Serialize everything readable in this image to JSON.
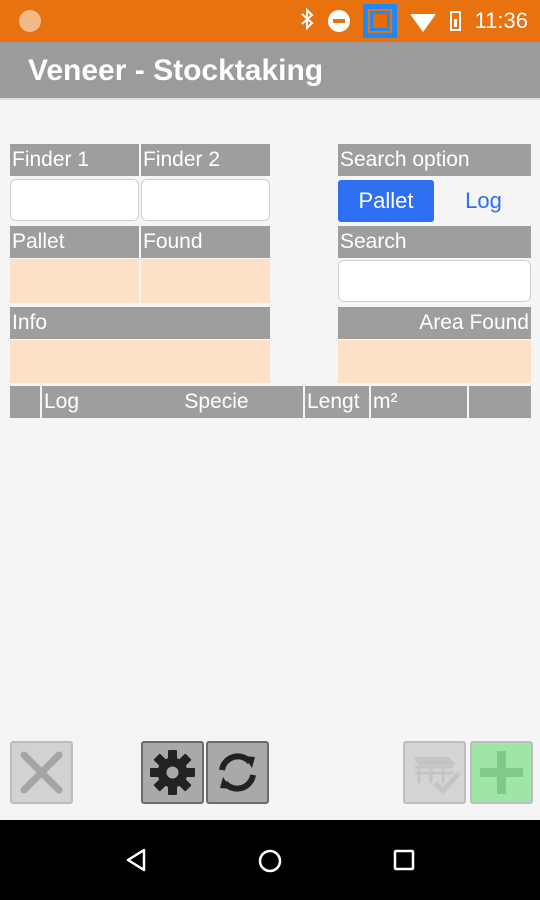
{
  "status_bar": {
    "time": "11:36",
    "icons": [
      "notification-dot-icon",
      "bluetooth-icon",
      "do-not-disturb-icon",
      "app-square-icon",
      "wifi-icon",
      "battery-icon"
    ]
  },
  "app": {
    "title": "Veneer - Stocktaking"
  },
  "form": {
    "finder1_label": "Finder 1",
    "finder2_label": "Finder 2",
    "finder1_value": "",
    "finder2_value": "",
    "pallet_label": "Pallet",
    "found_label": "Found",
    "info_label": "Info",
    "search_option_label": "Search option",
    "search_option_pallet": "Pallet",
    "search_option_log": "Log",
    "search_option_selected": "Pallet",
    "search_label": "Search",
    "search_value": "",
    "area_found_label": "Area Found"
  },
  "table": {
    "columns": [
      "",
      "Log",
      "Specie",
      "Lengt",
      "m²",
      ""
    ]
  },
  "toolbar": {
    "buttons": [
      "close-icon",
      "settings-gear-icon",
      "sync-icon",
      "pallet-check-icon",
      "add-icon"
    ]
  },
  "colors": {
    "status_bar": "#e8720f",
    "app_bar": "#9b9b9b",
    "header_cell": "#9e9e9e",
    "value_cell": "#fde0c8",
    "accent": "#2f6ff1",
    "add_button": "#9fe6a6"
  }
}
